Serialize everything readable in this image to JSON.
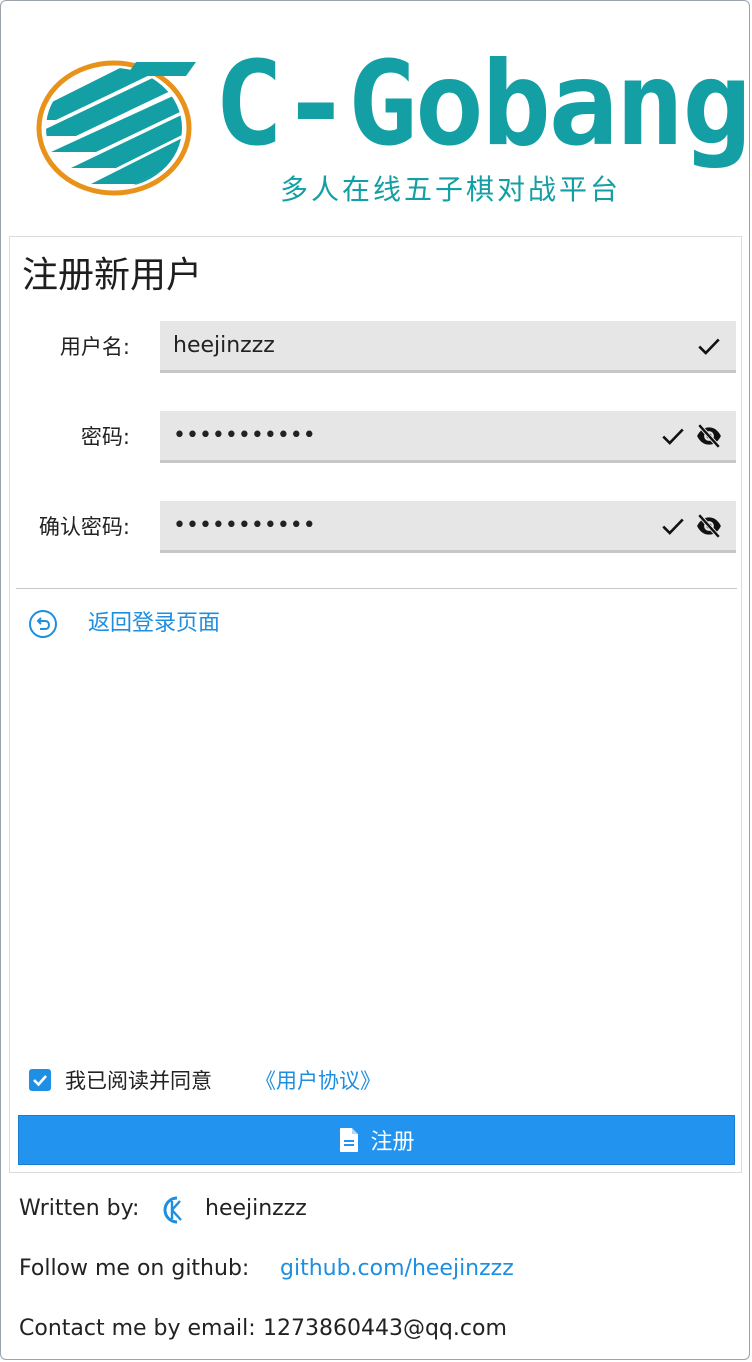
{
  "header": {
    "title": "C-Gobang",
    "subtitle": "多人在线五子棋对战平台"
  },
  "form": {
    "title": "注册新用户",
    "fields": [
      {
        "label": "用户名:",
        "value": "heejinzzz",
        "valid_icon": "check-icon"
      },
      {
        "label": "密码:",
        "value": "•••••••••••",
        "valid_icon": "check-icon",
        "toggle_icon": "eye-off-icon"
      },
      {
        "label": "确认密码:",
        "value": "•••••••••••",
        "valid_icon": "check-icon",
        "toggle_icon": "eye-off-icon"
      }
    ],
    "back_link": "返回登录页面",
    "agree_text": "我已阅读并同意",
    "agree_link": "《用户协议》",
    "agree_checked": true,
    "submit_label": "注册"
  },
  "footer": {
    "written_by_label": "Written by:",
    "author": "heejinzzz",
    "github_label": "Follow me on github:",
    "github_link": "github.com/heejinzzz",
    "email_label": "Contact me by email:",
    "email": "1273860443@qq.com"
  },
  "colors": {
    "brand_teal": "#139fa3",
    "logo_ring": "#e8921a",
    "link_blue": "#1e8fe0",
    "button_blue": "#2293ee"
  }
}
